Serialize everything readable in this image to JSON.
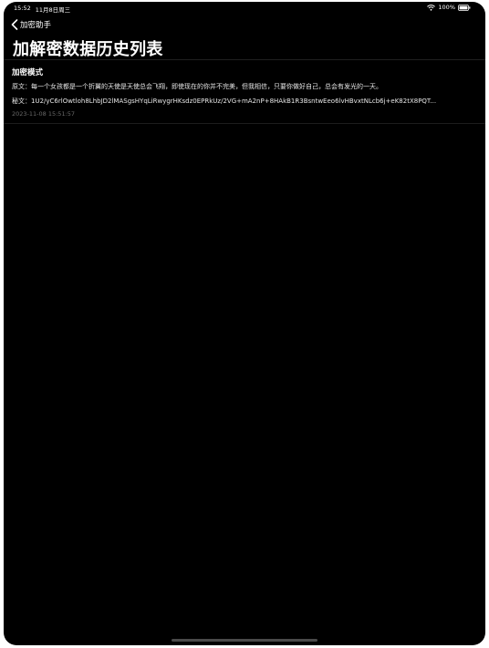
{
  "status_bar": {
    "time": "15:52",
    "date": "11月8日周三",
    "battery": "100%"
  },
  "nav": {
    "back_label": "加密助手"
  },
  "page": {
    "title": "加解密数据历史列表"
  },
  "records": [
    {
      "mode": "加密模式",
      "plain_prefix": "原文：",
      "plain_text": "每一个女孩都是一个折翼的天使是天使总会飞翔，即使现在的你并不完美，但我相信，只要你做好自己，总会有发光的一天。",
      "cipher_prefix": "秘文：",
      "cipher_text": "1U2/yC6rlOwtloh8LhbJD2lMASgsHYqLiRwygrHKsdz0EPRkUz/2VG+mA2nP+8HAkB1R3BsntwEeo6lvHBvxtNLcb6j+eK82tX8PQT...",
      "timestamp": "2023-11-08 15:51:57"
    }
  ],
  "colors": {
    "background": "#000000",
    "text": "#ffffff",
    "secondary_text": "#6a6a6a"
  }
}
